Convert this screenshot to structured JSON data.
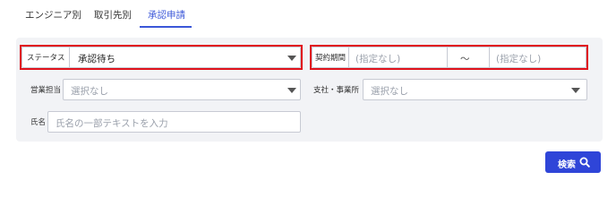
{
  "tabs": {
    "engineer": "エンジニア別",
    "client": "取引先別",
    "approval": "承認申請"
  },
  "filters": {
    "status": {
      "label": "ステータス",
      "value": "承認待ち"
    },
    "contract_period": {
      "label": "契約期間",
      "from_placeholder": "(指定なし)",
      "separator": "〜",
      "to_placeholder": "(指定なし)"
    },
    "sales_owner": {
      "label": "営業担当",
      "placeholder": "選択なし"
    },
    "branch_office": {
      "label": "支社・事業所",
      "placeholder": "選択なし"
    },
    "name": {
      "label": "氏名",
      "placeholder": "氏名の一部テキストを入力"
    }
  },
  "actions": {
    "search_label": "検索"
  },
  "icons": {
    "search": "search-icon",
    "dropdown": "chevron-down-icon"
  },
  "colors": {
    "accent": "#3b57d8",
    "button": "#2f45d8",
    "highlight": "#e0121c",
    "panel": "#f2f3f6"
  }
}
